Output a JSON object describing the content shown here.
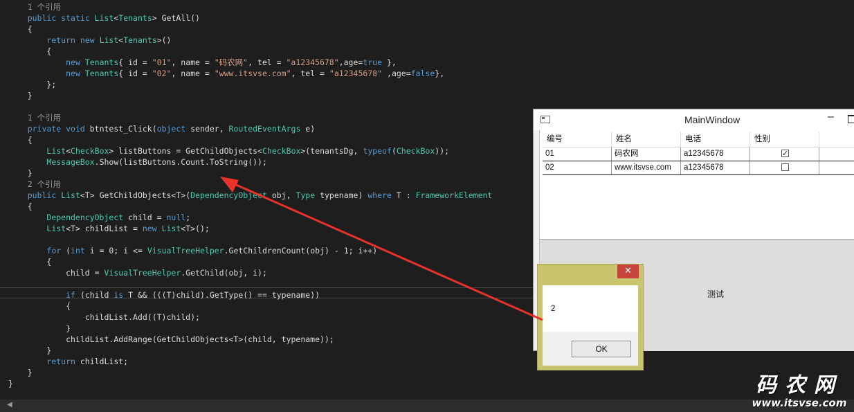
{
  "code": {
    "lines": [
      [
        {
          "t": "    "
        },
        {
          "t": "1 个引用",
          "c": "ref"
        }
      ],
      [
        {
          "t": "    "
        },
        {
          "t": "public static ",
          "c": "kw"
        },
        {
          "t": "List",
          "c": "ty"
        },
        {
          "t": "<"
        },
        {
          "t": "Tenants",
          "c": "ty"
        },
        {
          "t": "> GetAll()"
        }
      ],
      [
        {
          "t": "    {"
        }
      ],
      [
        {
          "t": "        "
        },
        {
          "t": "return new ",
          "c": "kw"
        },
        {
          "t": "List",
          "c": "ty"
        },
        {
          "t": "<"
        },
        {
          "t": "Tenants",
          "c": "ty"
        },
        {
          "t": ">()"
        }
      ],
      [
        {
          "t": "        {"
        }
      ],
      [
        {
          "t": "            "
        },
        {
          "t": "new ",
          "c": "kw"
        },
        {
          "t": "Tenants",
          "c": "ty"
        },
        {
          "t": "{ id = "
        },
        {
          "t": "\"01\"",
          "c": "st"
        },
        {
          "t": ", name = "
        },
        {
          "t": "\"码农网\"",
          "c": "st"
        },
        {
          "t": ", tel = "
        },
        {
          "t": "\"a12345678\"",
          "c": "st"
        },
        {
          "t": ",age="
        },
        {
          "t": "true",
          "c": "kw"
        },
        {
          "t": " },"
        }
      ],
      [
        {
          "t": "            "
        },
        {
          "t": "new ",
          "c": "kw"
        },
        {
          "t": "Tenants",
          "c": "ty"
        },
        {
          "t": "{ id = "
        },
        {
          "t": "\"02\"",
          "c": "st"
        },
        {
          "t": ", name = "
        },
        {
          "t": "\"www.itsvse.com\"",
          "c": "st"
        },
        {
          "t": ", tel = "
        },
        {
          "t": "\"a12345678\"",
          "c": "st"
        },
        {
          "t": " ,age="
        },
        {
          "t": "false",
          "c": "kw"
        },
        {
          "t": "},"
        }
      ],
      [
        {
          "t": "        };"
        }
      ],
      [
        {
          "t": "    }"
        }
      ],
      [
        {
          "t": ""
        }
      ],
      [
        {
          "t": "    "
        },
        {
          "t": "1 个引用",
          "c": "ref"
        }
      ],
      [
        {
          "t": "    "
        },
        {
          "t": "private void ",
          "c": "kw"
        },
        {
          "t": "btntest_Click("
        },
        {
          "t": "object ",
          "c": "kw"
        },
        {
          "t": "sender, "
        },
        {
          "t": "RoutedEventArgs",
          "c": "ty"
        },
        {
          "t": " e)"
        }
      ],
      [
        {
          "t": "    {"
        }
      ],
      [
        {
          "t": "        "
        },
        {
          "t": "List",
          "c": "ty"
        },
        {
          "t": "<"
        },
        {
          "t": "CheckBox",
          "c": "ty"
        },
        {
          "t": "> listButtons = GetChildObjects<"
        },
        {
          "t": "CheckBox",
          "c": "ty"
        },
        {
          "t": ">(tenantsDg, "
        },
        {
          "t": "typeof",
          "c": "kw"
        },
        {
          "t": "("
        },
        {
          "t": "CheckBox",
          "c": "ty"
        },
        {
          "t": "));"
        }
      ],
      [
        {
          "t": "        "
        },
        {
          "t": "MessageBox",
          "c": "ty"
        },
        {
          "t": ".Show(listButtons.Count.ToString());"
        }
      ],
      [
        {
          "t": "    }"
        }
      ],
      [
        {
          "t": "    "
        },
        {
          "t": "2 个引用",
          "c": "ref"
        }
      ],
      [
        {
          "t": "    "
        },
        {
          "t": "public ",
          "c": "kw"
        },
        {
          "t": "List",
          "c": "ty"
        },
        {
          "t": "<T> GetChildObjects<T>("
        },
        {
          "t": "DependencyObject",
          "c": "ty"
        },
        {
          "t": " obj, "
        },
        {
          "t": "Type",
          "c": "ty"
        },
        {
          "t": " typename) "
        },
        {
          "t": "where ",
          "c": "kw"
        },
        {
          "t": "T : "
        },
        {
          "t": "FrameworkElement",
          "c": "ty"
        }
      ],
      [
        {
          "t": "    {"
        }
      ],
      [
        {
          "t": "        "
        },
        {
          "t": "DependencyObject",
          "c": "ty"
        },
        {
          "t": " child = "
        },
        {
          "t": "null",
          "c": "kw"
        },
        {
          "t": ";"
        }
      ],
      [
        {
          "t": "        "
        },
        {
          "t": "List",
          "c": "ty"
        },
        {
          "t": "<T> childList = "
        },
        {
          "t": "new ",
          "c": "kw"
        },
        {
          "t": "List",
          "c": "ty"
        },
        {
          "t": "<T>();"
        }
      ],
      [
        {
          "t": ""
        }
      ],
      [
        {
          "t": "        "
        },
        {
          "t": "for ",
          "c": "kw"
        },
        {
          "t": "("
        },
        {
          "t": "int ",
          "c": "kw"
        },
        {
          "t": "i = 0; i <= "
        },
        {
          "t": "VisualTreeHelper",
          "c": "ty"
        },
        {
          "t": ".GetChildrenCount(obj) - 1; i++)"
        }
      ],
      [
        {
          "t": "        {"
        }
      ],
      [
        {
          "t": "            child = "
        },
        {
          "t": "VisualTreeHelper",
          "c": "ty"
        },
        {
          "t": ".GetChild(obj, i);"
        }
      ],
      [
        {
          "t": ""
        }
      ],
      [
        {
          "t": "            "
        },
        {
          "t": "if ",
          "c": "kw"
        },
        {
          "t": "(child "
        },
        {
          "t": "is ",
          "c": "kw"
        },
        {
          "t": "T && (((T)child).GetType() == typename))"
        }
      ],
      [
        {
          "t": "            {"
        }
      ],
      [
        {
          "t": "                childList.Add((T)child);"
        }
      ],
      [
        {
          "t": "            }"
        }
      ],
      [
        {
          "t": "            childList.AddRange(GetChildObjects<T>(child, typename));"
        }
      ],
      [
        {
          "t": "        }"
        }
      ],
      [
        {
          "t": "        "
        },
        {
          "t": "return ",
          "c": "kw"
        },
        {
          "t": "childList;"
        }
      ],
      [
        {
          "t": "    }"
        }
      ],
      [
        {
          "t": "}"
        }
      ]
    ]
  },
  "main_window": {
    "title": "MainWindow",
    "minimize_glyph": "–",
    "grid": {
      "headers": [
        "编号",
        "姓名",
        "电话",
        "性别"
      ],
      "rows": [
        {
          "id": "01",
          "name": "码农网",
          "tel": "a12345678",
          "age": true
        },
        {
          "id": "02",
          "name": "www.itsvse.com",
          "tel": "a12345678",
          "age": false
        }
      ]
    },
    "button_label": "测试"
  },
  "message_box": {
    "close_glyph": "✕",
    "text": "2",
    "ok_label": "OK"
  },
  "watermark": {
    "chinese": "码农网",
    "url": "www.itsvse.com"
  },
  "colors": {
    "keyword": "#569cd6",
    "type": "#4ec9b0",
    "string": "#d69d85",
    "arrow": "#e8332c",
    "msgbox_frame": "#c9c56e"
  }
}
